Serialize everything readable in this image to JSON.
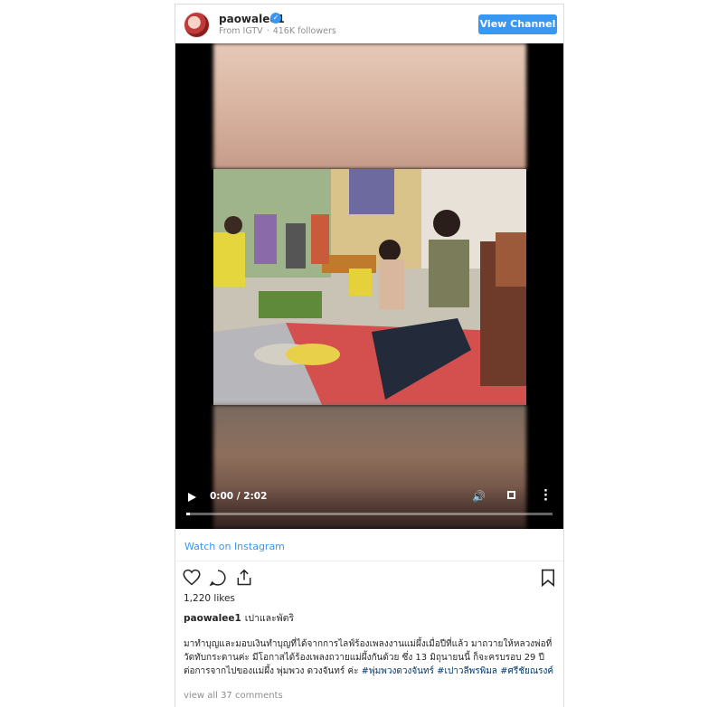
{
  "header": {
    "username": "paowalee1",
    "source": "From IGTV",
    "followers": "416K followers",
    "view_button": "View Channel"
  },
  "video": {
    "time": "0:00 / 2:02",
    "progress": 0.01
  },
  "watch_link": "Watch on Instagram",
  "post": {
    "likes": "1,220 likes",
    "caption_user": "paowalee1",
    "caption_title": "เปาและพัตริ",
    "caption_body": "มาทำบุญและมอบเงินทำบุญที่ได้จากการไลฟ์ร้องเพลงงานแม่ผึ้งเมื่อปีที่แล้ว มาถวายให้หลวงพ่อที่วัดทับกระดานค่ะ มีโอกาสได้ร้องเพลงถวายแม่ผึ้งกันด้วย ซึ่ง 13 มิถุนายนนี้ ก็จะครบรอบ 29 ปีต่อการจากไปของแม่ผึ้ง พุ่มพวง ดวงจันทร์ ค่ะ",
    "hashtags": "#พุ่มพวงดวงจันทร์ #เปาวลีพรพิมล #ศรีชัยณรงค์",
    "view_comments": "view all 37 comments"
  },
  "colors": {
    "accent": "#3897f0",
    "text": "#262626",
    "muted": "#8e8e8e",
    "hashtag": "#00376b"
  },
  "icons": [
    "verified-badge-icon",
    "play-icon",
    "volume-icon",
    "fullscreen-icon",
    "more-options-icon",
    "heart-icon",
    "comment-icon",
    "share-icon",
    "bookmark-icon"
  ]
}
